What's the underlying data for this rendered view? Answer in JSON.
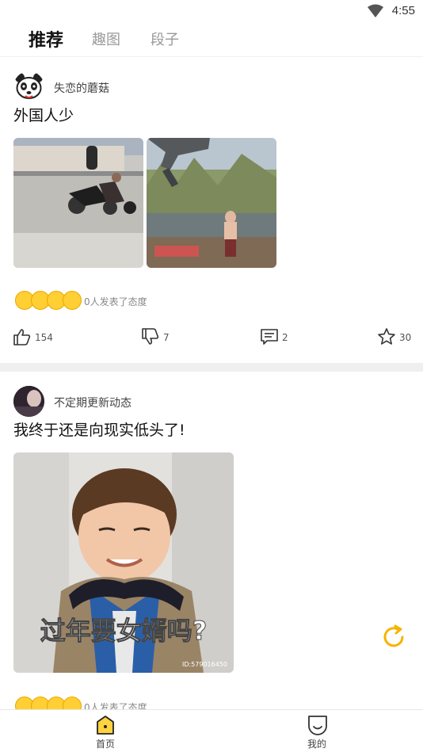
{
  "status_bar": {
    "time": "4:55",
    "wifi_icon": "wifi-icon"
  },
  "tabs": [
    {
      "label": "推荐",
      "active": true
    },
    {
      "label": "趣图",
      "active": false
    },
    {
      "label": "段子",
      "active": false
    }
  ],
  "posts": [
    {
      "author": "失恋的蘑菇",
      "title": "外国人少",
      "image_count": 2,
      "reaction_text": "0人发表了态度",
      "actions": {
        "like": "154",
        "dislike": "7",
        "comment": "2",
        "favorite": "30"
      }
    },
    {
      "author": "不定期更新动态",
      "title": "我终于还是向现实低头了!",
      "image_overlay_text": "过年要女婿吗?",
      "image_watermark": "ID:579016450",
      "reaction_text": "0人发表了态度"
    }
  ],
  "bottom_nav": [
    {
      "label": "首页",
      "icon": "home-icon",
      "active": true
    },
    {
      "label": "我的",
      "icon": "profile-icon",
      "active": false
    }
  ],
  "colors": {
    "accent": "#ffd23f",
    "refresh": "#f5b400",
    "divider": "#efefef"
  }
}
